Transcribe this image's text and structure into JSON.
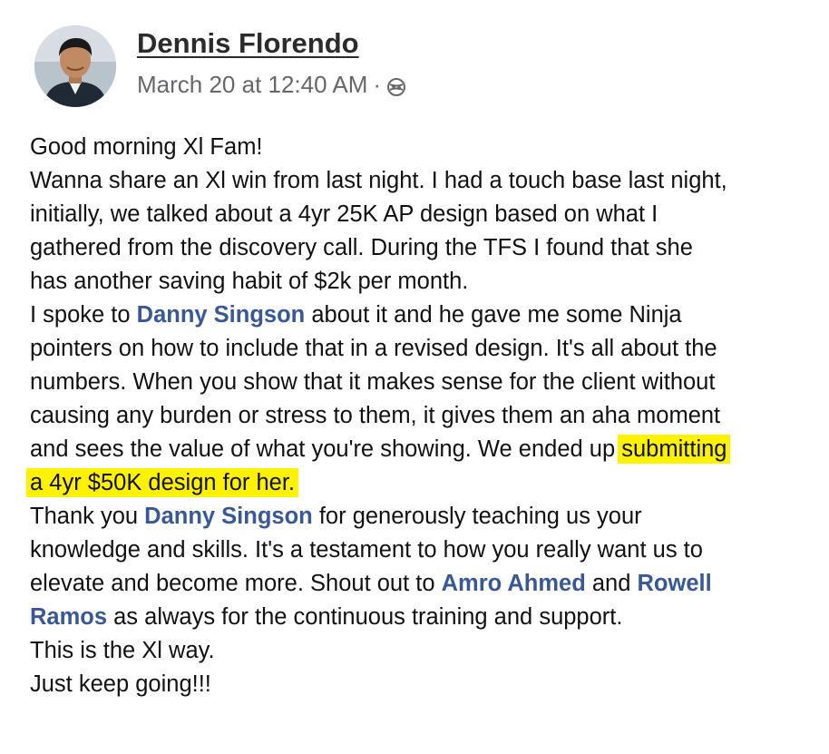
{
  "post": {
    "author": "Dennis Florendo",
    "timestamp": "March 20 at 12:40 AM",
    "separator": "·",
    "privacy_icon": "globe-icon"
  },
  "colors": {
    "mention": "#385898",
    "highlight": "#fff200",
    "meta": "#65676b"
  },
  "text": {
    "l1": "Good morning Xl Fam!",
    "l2": "Wanna share an Xl win from last night. I had a touch base last night,",
    "l3": "initially, we talked about a 4yr 25K AP design based on what I",
    "l4": "gathered from the discovery call. During the TFS I found that she",
    "l5": "has another saving habit of $2k per month.",
    "l6a": "I spoke to ",
    "l6m": "Danny Singson",
    "l6b": " about it and he gave me some Ninja",
    "l7": "pointers on how to include that in a revised design. It's all about the",
    "l8": "numbers. When you show that it makes sense for the client without",
    "l9": "causing any burden or stress to them, it gives them an aha moment",
    "l10a": "and sees the value of what you're showing. We ended up ",
    "l10h": "submitting",
    "l11h": "a 4yr $50K design for her.",
    "l12a": "Thank you ",
    "l12m": "Danny Singson",
    "l12b": " for generously teaching us your",
    "l13": "knowledge and skills. It's a testament to how you really want us to",
    "l14a": "elevate and become more. Shout out to ",
    "l14m1": "Amro Ahmed",
    "l14b": " and ",
    "l14m2": "Rowell",
    "l15m": "Ramos",
    "l15b": " as always for the continuous training and support.",
    "l16": "This is the Xl way.",
    "l17": "Just keep going!!!"
  }
}
